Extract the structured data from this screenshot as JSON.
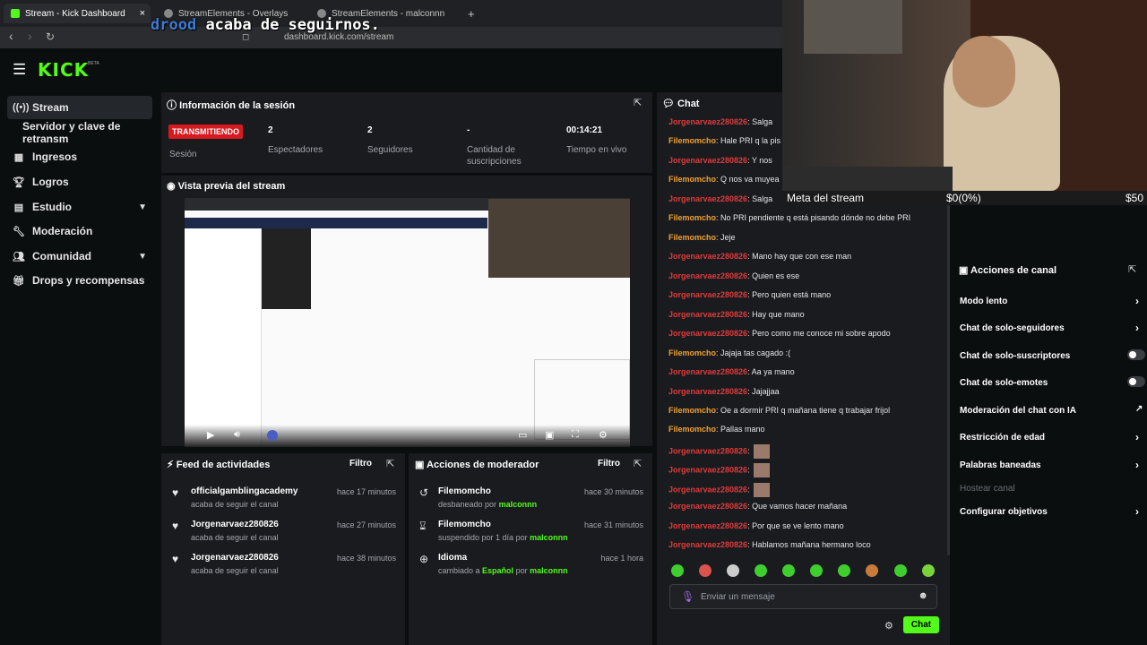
{
  "browser": {
    "tabs": [
      {
        "label": "Stream - Kick Dashboard",
        "active": true
      },
      {
        "label": "StreamElements - Overlays"
      },
      {
        "label": "StreamElements - malconnn"
      }
    ],
    "new_tab": "+",
    "close": "×",
    "url": "dashboard.kick.com/stream"
  },
  "overlay": {
    "name": "drood",
    "message": "acaba de seguirnos."
  },
  "header": {
    "logo": "KICK",
    "beta": "BETA"
  },
  "sidebar": {
    "items": [
      {
        "label": "Stream",
        "icon": "broadcast-icon"
      },
      {
        "label": "Servidor y clave de retransm"
      },
      {
        "label": "Ingresos",
        "icon": "chart-icon"
      },
      {
        "label": "Logros",
        "icon": "trophy-icon"
      },
      {
        "label": "Estudio",
        "icon": "studio-icon"
      },
      {
        "label": "Moderación",
        "icon": "wrench-icon"
      },
      {
        "label": "Comunidad",
        "icon": "people-icon"
      },
      {
        "label": "Drops y recompensas",
        "icon": "gift-icon"
      }
    ]
  },
  "session": {
    "title": "Información de la sesión",
    "status": "TRANSMITIENDO",
    "status_label": "Sesión",
    "viewers": "2",
    "viewers_label": "Espectadores",
    "followers": "2",
    "followers_label": "Seguidores",
    "subs": "-",
    "subs_label": "Cantidad de suscripciones",
    "uptime": "00:14:21",
    "uptime_label": "Tiempo en vivo"
  },
  "preview": {
    "title": "Vista previa del stream"
  },
  "activity": {
    "title": "Feed de actividades",
    "filter": "Filtro",
    "items": [
      {
        "user": "officialgamblingacademy",
        "action": "acaba de seguir el canal",
        "time": "hace 17 minutos"
      },
      {
        "user": "Jorgenarvaez280826",
        "action": "acaba de seguir el canal",
        "time": "hace 27 minutos"
      },
      {
        "user": "Jorgenarvaez280826",
        "action": "acaba de seguir el canal",
        "time": "hace 38 minutos"
      }
    ]
  },
  "modactions": {
    "title": "Acciones de moderador",
    "filter": "Filtro",
    "items": [
      {
        "user": "Filemomcho",
        "action": "desbaneado por",
        "by": "malconnn",
        "time": "hace 30 minutos"
      },
      {
        "user": "Filemomcho",
        "action": "suspendido por 1 día por",
        "by": "malconnn",
        "time": "hace 31 minutos"
      },
      {
        "user": "Idioma",
        "action": "cambiado a",
        "value": "Español",
        "por": "por",
        "by": "malconnn",
        "time": "hace 1 hora"
      }
    ]
  },
  "chat": {
    "title": "Chat",
    "messages": [
      {
        "user": "Jorgenarvaez280826",
        "text": "Salga"
      },
      {
        "user": "Filemomcho",
        "text": "Hale PRI q la pis"
      },
      {
        "user": "Jorgenarvaez280826",
        "text": "Y nos"
      },
      {
        "user": "Filemomcho",
        "text": "Q nos va muyea"
      },
      {
        "user": "Jorgenarvaez280826",
        "text": "Salga"
      },
      {
        "user": "Filemomcho",
        "text": "No PRI pendiente q está pisando dónde no debe PRI"
      },
      {
        "user": "Filemomcho",
        "text": "Jeje"
      },
      {
        "user": "Jorgenarvaez280826",
        "text": "Mano hay que con ese man"
      },
      {
        "user": "Jorgenarvaez280826",
        "text": "Quien es ese"
      },
      {
        "user": "Jorgenarvaez280826",
        "text": "Pero quien está mano"
      },
      {
        "user": "Jorgenarvaez280826",
        "text": "Hay que mano"
      },
      {
        "user": "Jorgenarvaez280826",
        "text": "Pero como me conoce mi sobre apodo"
      },
      {
        "user": "Filemomcho",
        "text": "Jajaja tas cagado :("
      },
      {
        "user": "Jorgenarvaez280826",
        "text": "Aa ya mano"
      },
      {
        "user": "Jorgenarvaez280826",
        "text": "Jajajjaa"
      },
      {
        "user": "Filemomcho",
        "text": "Oe a dormir PRI q mañana tiene q trabajar frijol"
      },
      {
        "user": "Filemomcho",
        "text": "Pallas mano"
      },
      {
        "user": "Jorgenarvaez280826",
        "text": ""
      },
      {
        "user": "Jorgenarvaez280826",
        "text": ""
      },
      {
        "user": "Jorgenarvaez280826",
        "text": ""
      },
      {
        "user": "Jorgenarvaez280826",
        "text": "Que vamos hacer mañana"
      },
      {
        "user": "Jorgenarvaez280826",
        "text": "Por que se ve lento mano"
      },
      {
        "user": "Jorgenarvaez280826",
        "text": "Hablamos mañana hermano loco"
      }
    ],
    "placeholder": "Enviar un mensaje",
    "send": "Chat"
  },
  "goal": {
    "label": "Meta del stream",
    "progress": "$0(0%)",
    "target": "$50"
  },
  "channel_actions": {
    "title": "Acciones de canal",
    "items": [
      {
        "label": "Modo lento",
        "control": "chevron"
      },
      {
        "label": "Chat de solo-seguidores",
        "control": "chevron"
      },
      {
        "label": "Chat de solo-suscriptores",
        "control": "toggle"
      },
      {
        "label": "Chat de solo-emotes",
        "control": "toggle"
      },
      {
        "label": "Moderación del chat con IA",
        "control": "link"
      },
      {
        "label": "Restricción de edad",
        "control": "chevron"
      },
      {
        "label": "Palabras baneadas",
        "control": "chevron"
      },
      {
        "label": "Hostear canal",
        "control": "none"
      },
      {
        "label": "Configurar objetivos",
        "control": "chevron"
      }
    ]
  },
  "colors": {
    "accent": "#53fc18",
    "live": "#d71920",
    "user_a": "#e03b3b",
    "user_b": "#f0a030"
  }
}
